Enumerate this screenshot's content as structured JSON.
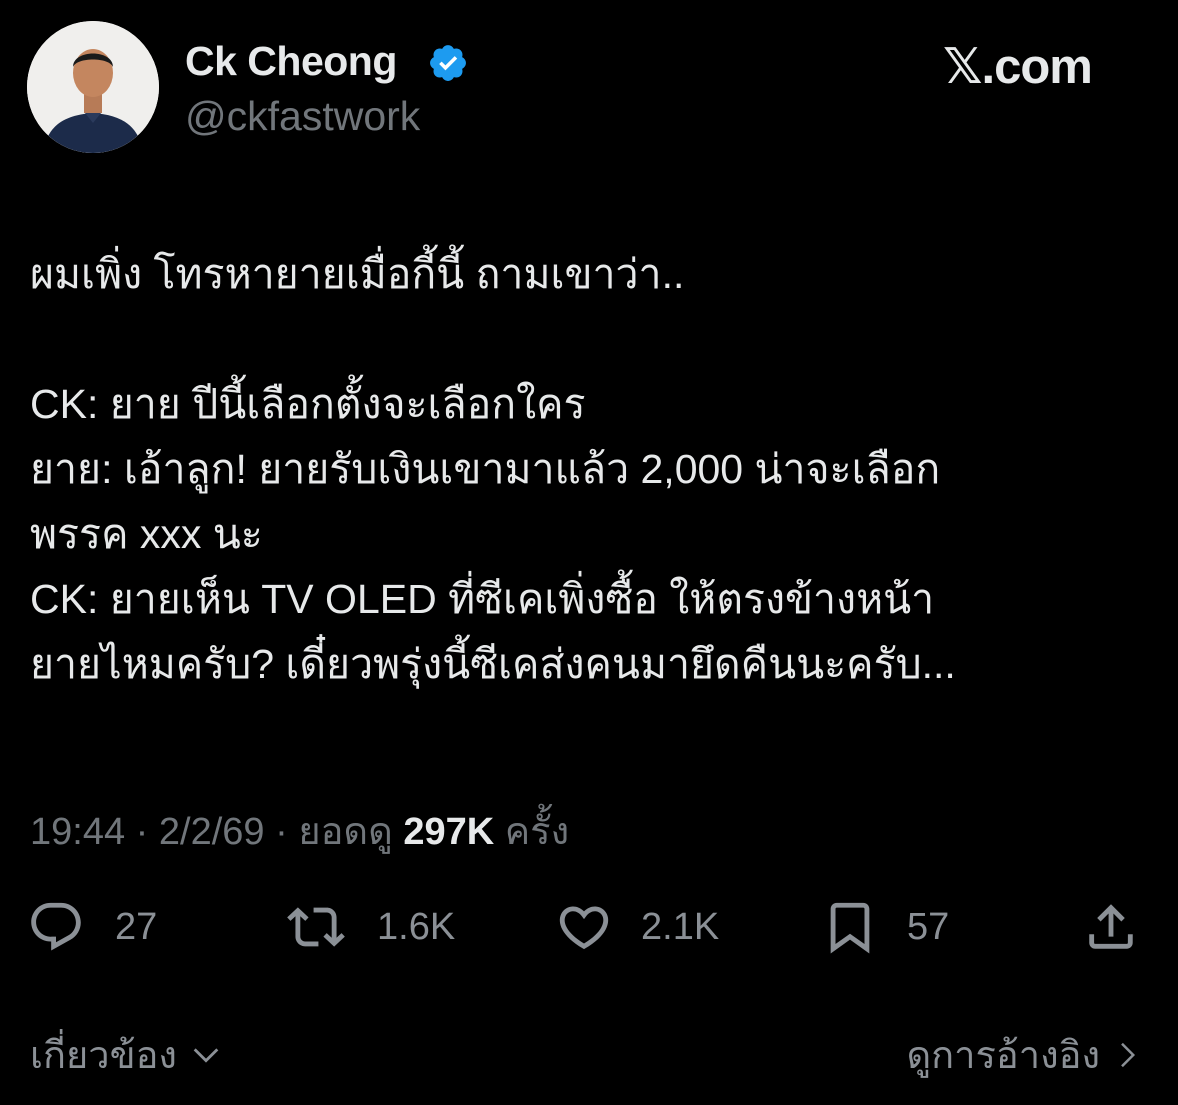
{
  "header": {
    "display_name": "Ck Cheong",
    "handle": "@ckfastwork",
    "brand": "𝕏.com",
    "verified_color": "#1d9bf0"
  },
  "tweet": {
    "text": "ผมเพิ่ง โทรหายายเมื่อกี้นี้ ถามเขาว่า..\n\nCK: ยาย ปีนี้เลือกตั้งจะเลือกใคร\nยาย: เอ้าลูก! ยายรับเงินเขามาแล้ว 2,000 น่าจะเลือก\nพรรค xxx นะ\nCK: ยายเห็น TV OLED ที่ซีเคเพิ่งซื้อ ให้ตรงข้างหน้า\nยายไหมครับ? เดี๋ยวพรุ่งนี้ซีเคส่งคนมายึดคืนนะครับ...",
    "time": "19:44",
    "date": "2/2/69",
    "views_label": "ยอดดู",
    "views": "297K",
    "views_suffix": "ครั้ง"
  },
  "actions": {
    "replies": "27",
    "reposts": "1.6K",
    "likes": "2.1K",
    "bookmarks": "57"
  },
  "footer": {
    "related": "เกี่ยวข้อง",
    "view_quotes": "ดูการอ้างอิง"
  },
  "icons": [
    "reply-icon",
    "repost-icon",
    "like-icon",
    "bookmark-icon",
    "share-icon",
    "chevron-down-icon",
    "chevron-right-icon",
    "verified-badge-icon"
  ]
}
